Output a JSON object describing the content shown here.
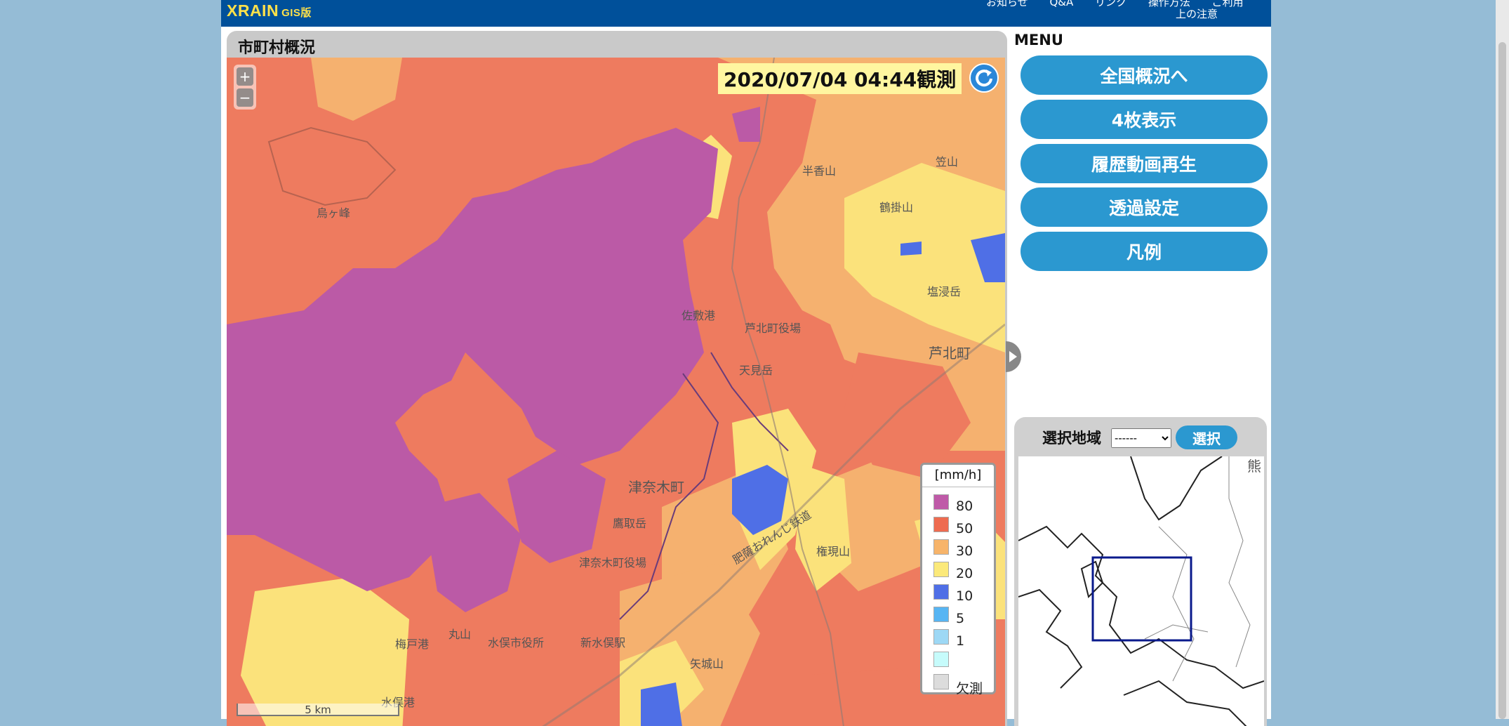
{
  "header": {
    "logo": "XRAIN",
    "logo_sub": "GIS版",
    "links": [
      "お知らせ",
      "Q&A",
      "リンク",
      "操作方法",
      "ご利用"
    ],
    "notice_line2": "上の注意"
  },
  "map_panel": {
    "title": "市町村概況",
    "timestamp": "2020/07/04 04:44観測",
    "zoom_in": "+",
    "zoom_out": "−",
    "scale_label": "5 km",
    "places": {
      "p1": "烏ヶ峰",
      "p2": "佐敷港",
      "p3": "芦北町役場",
      "p4": "天見岳",
      "p5": "芦北町",
      "p6": "津奈木町",
      "p7": "津奈木町役場",
      "p8": "水俣市役所",
      "p9": "新水俣駅",
      "p10": "梅戸港",
      "p11": "丸山",
      "p12": "矢城山",
      "p13": "権現山",
      "p14": "塩浸岳",
      "p15": "笠山",
      "p16": "鶴掛山",
      "p17": "半香山",
      "p18": "肥薩おれんじ鉄道",
      "p19": "鷹取岳",
      "p20": "水俣港"
    },
    "legend": {
      "title": "[mm/h]",
      "items": [
        {
          "label": "80",
          "color": "#bf5aa8"
        },
        {
          "label": "50",
          "color": "#ee6b50"
        },
        {
          "label": "30",
          "color": "#f7b46a"
        },
        {
          "label": "20",
          "color": "#fbe97a"
        },
        {
          "label": "10",
          "color": "#4f6fe6"
        },
        {
          "label": "5",
          "color": "#57b5f3"
        },
        {
          "label": "1",
          "color": "#9dd8f5"
        },
        {
          "label": "",
          "color": "#c6fbfb"
        },
        {
          "label": "欠測",
          "color": "#dcdcdc"
        }
      ]
    }
  },
  "menu": {
    "title": "MENU",
    "buttons": [
      "全国概況へ",
      "4枚表示",
      "履歴動画再生",
      "透過設定",
      "凡例"
    ]
  },
  "area_selector": {
    "label": "選択地域",
    "select_value": "------",
    "button": "選択",
    "map_label": "熊"
  },
  "colors": {
    "header_bg": "#00509a",
    "logo": "#ffe14a",
    "button": "#2b98d0",
    "page_bg": "#95bcd6"
  }
}
